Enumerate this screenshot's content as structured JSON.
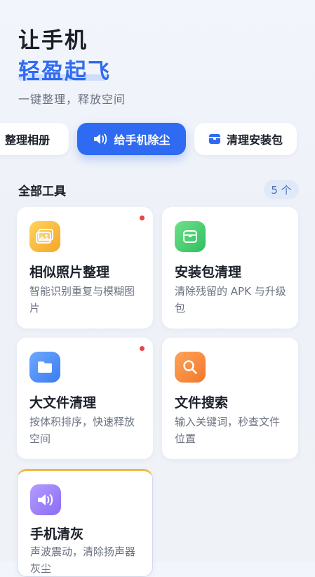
{
  "hero": {
    "title": "让手机",
    "accent": "轻盈起飞",
    "subtitle": "一键整理，释放空间"
  },
  "chips": [
    {
      "label": "整理相册",
      "icon": "none"
    },
    {
      "label": "给手机除尘",
      "icon": "speaker-icon",
      "active": true
    },
    {
      "label": "清理安装包",
      "icon": "package-icon"
    }
  ],
  "section": {
    "title": "全部工具",
    "count": "5 个"
  },
  "tools": [
    {
      "name": "相似照片整理",
      "desc": "智能识别重复与模糊图片",
      "icon": "photo-icon",
      "color": "#f4a62a",
      "badge": true
    },
    {
      "name": "安装包清理",
      "desc": "清除残留的 APK 与升级包",
      "icon": "package-icon",
      "color": "#2fbf5e",
      "badge": false
    },
    {
      "name": "大文件清理",
      "desc": "按体积排序，快速释放空间",
      "icon": "folder-icon",
      "color": "#3b7cf0",
      "badge": true
    },
    {
      "name": "文件搜索",
      "desc": "输入关键词，秒查文件位置",
      "icon": "search-icon",
      "color": "#f2782a",
      "badge": false
    },
    {
      "name": "手机清灰",
      "desc": "声波震动，清除扬声器灰尘",
      "icon": "speaker-icon",
      "color": "#8b6cf5",
      "badge": false
    }
  ]
}
